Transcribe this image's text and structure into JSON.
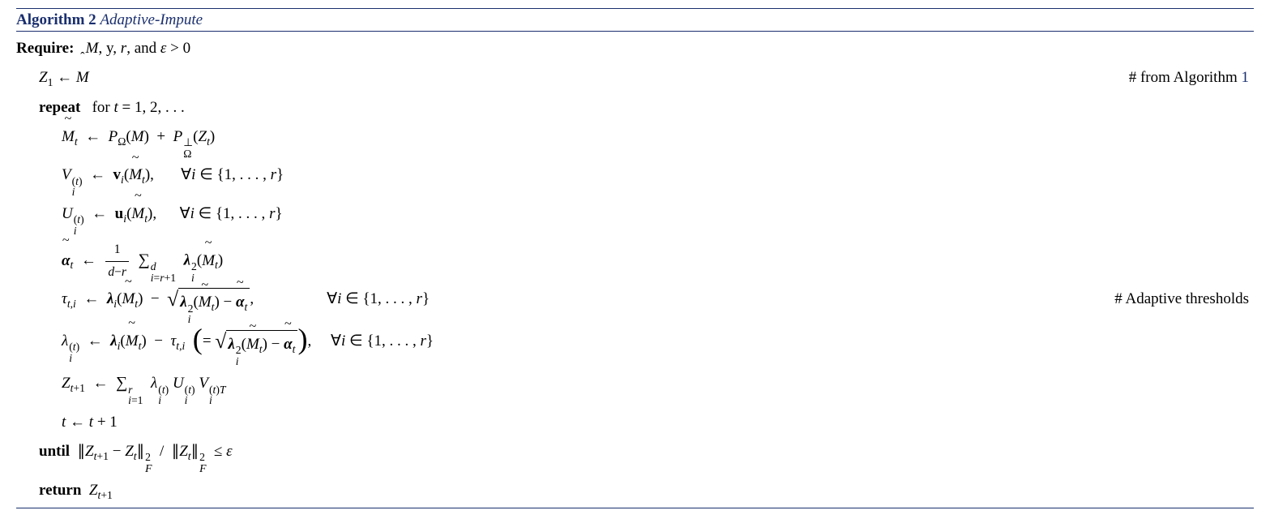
{
  "header": {
    "algo_label": "Algorithm 2",
    "algo_name": "Adaptive-Impute"
  },
  "require": {
    "label": "Require:",
    "text_inputs": "M, y, r,",
    "text_and": "and",
    "text_eps": "ε > 0"
  },
  "lines": {
    "init_lhs": "Z",
    "init_sub": "1",
    "arrow": "←",
    "init_rhs_var": "M",
    "init_comment_pre": "# from Algorithm ",
    "init_comment_ref": "1",
    "repeat_kw": "repeat",
    "repeat_cond": "for t = 1, 2, . . .",
    "mtilde_line": "M̃_t ← 𝒫_Ω(M) + 𝒫_Ω^⊥(Z_t)",
    "v_line": "V_i^(t) ← v_i(M̃_t),    ∀i ∈ {1, …, r}",
    "u_line": "U_i^(t) ← u_i(M̃_t),    ∀i ∈ {1, …, r}",
    "alpha_line": "α̃_t ← 1/(d−r) Σ_{i=r+1}^d λ_i^2(M̃_t)",
    "tau_line": "τ_{t,i} ← λ_i(M̃_t) − √(λ_i^2(M̃_t) − α̃_t),    ∀i ∈ {1, …, r}",
    "tau_comment": "# Adaptive thresholds",
    "lambda_line": "λ_i^(t) ← λ_i(M̃_t) − τ_{t,i} ( = √(λ_i^2(M̃_t) − α̃_t) ),    ∀i ∈ {1, …, r}",
    "z_line": "Z_{t+1} ← Σ_{i=1}^r λ_i^(t) U_i^(t) V_i^(t)T",
    "t_line": "t ← t + 1",
    "until_kw": "until",
    "until_cond": "∥Z_{t+1} − Z_t∥_F^2 / ∥Z_t∥_F^2 ≤ ε",
    "return_kw": "return",
    "return_val": "Z_{t+1}",
    "forall_set": "∀i ∈ {1, . . . , r}"
  }
}
